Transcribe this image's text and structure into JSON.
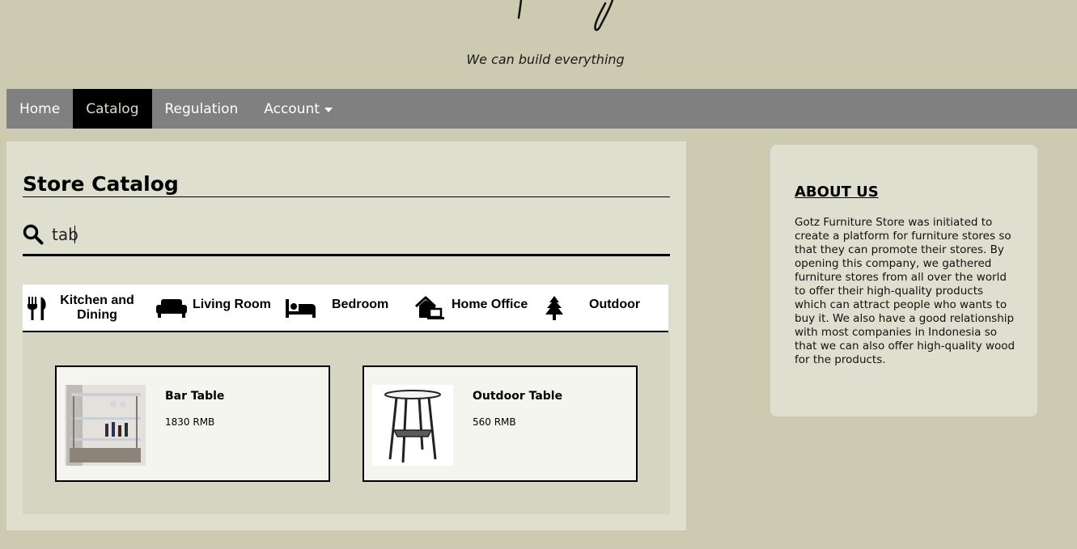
{
  "header": {
    "tagline": "We can build everything"
  },
  "navbar": {
    "items": [
      {
        "label": "Home"
      },
      {
        "label": "Catalog"
      },
      {
        "label": "Regulation"
      },
      {
        "label": "Account"
      }
    ],
    "active": "Catalog"
  },
  "catalog": {
    "title": "Store Catalog",
    "search": {
      "value": "tab",
      "placeholder": ""
    },
    "categories": [
      {
        "label": "Kitchen and Dining",
        "icon": "utensils-icon"
      },
      {
        "label": "Living Room",
        "icon": "couch-icon"
      },
      {
        "label": "Bedroom",
        "icon": "bed-icon"
      },
      {
        "label": "Home Office",
        "icon": "home-office-icon"
      },
      {
        "label": "Outdoor",
        "icon": "tree-icon"
      }
    ],
    "products": [
      {
        "name": "Bar Table",
        "price": "1830 RMB"
      },
      {
        "name": "Outdoor Table",
        "price": "560 RMB"
      }
    ]
  },
  "about": {
    "title": "ABOUT US",
    "text": "Gotz Furniture Store was initiated to create a platform for furniture stores so that they can promote their stores. By opening this company, we gathered furniture stores from all over the world to offer their high-quality products which can attract people who wants to buy it. We also have a good relationship with most companies in Indonesia so that we can also offer high-quality wood for the products."
  },
  "colors": {
    "background": "#cccbb2",
    "navbar": "#808080",
    "nav_active": "#000000",
    "panel": "#dfdfd0"
  }
}
